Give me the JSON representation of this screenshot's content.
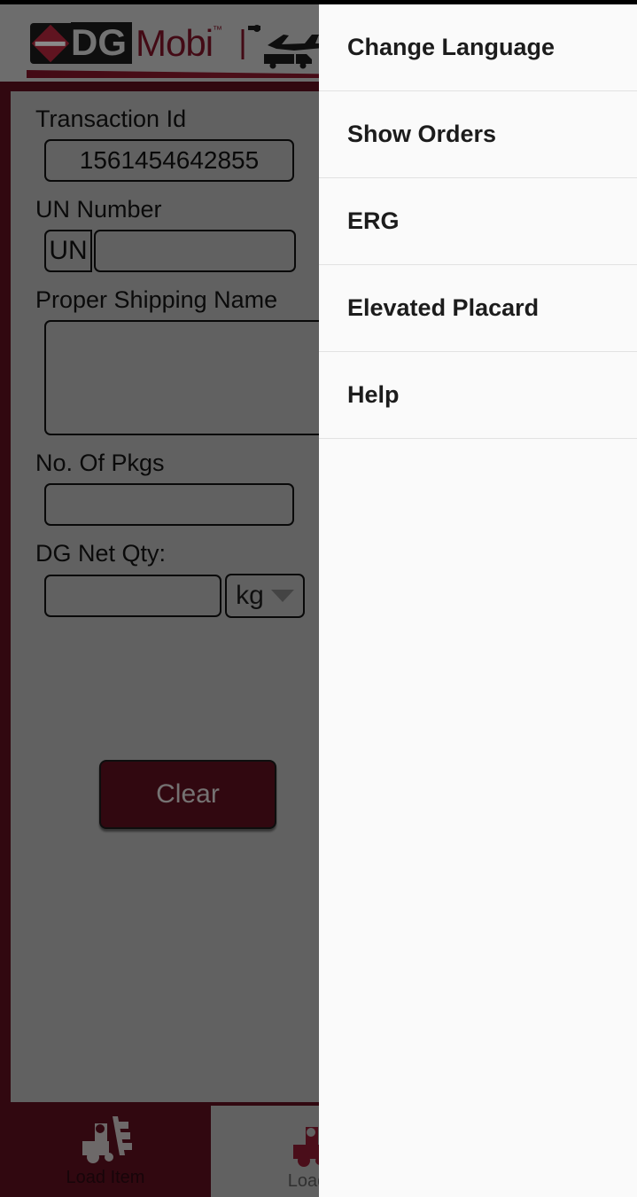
{
  "header": {
    "logo_dg": "DG",
    "logo_mobi": "Mobi",
    "logo_tm": "™",
    "transport_art": "airplane-truck-ship-silhouette"
  },
  "form": {
    "transaction": {
      "label": "Transaction Id",
      "value": "1561454642855"
    },
    "un_number": {
      "label": "UN Number",
      "prefix": "UN",
      "value": ""
    },
    "proper_shipping_name": {
      "label": "Proper Shipping Name",
      "value": ""
    },
    "no_of_pkgs": {
      "label": "No. Of Pkgs",
      "value": ""
    },
    "dg_net_qty": {
      "label": "DG Net Qty:",
      "value": "",
      "unit": "kg"
    },
    "clear_button": "Clear"
  },
  "tabs": [
    {
      "label": "Load Item",
      "icon": "forklift-icon",
      "active": true
    },
    {
      "label": "Load D",
      "icon": "forklift-icon",
      "active": false
    }
  ],
  "menu": {
    "items": [
      {
        "label": "Change Language"
      },
      {
        "label": "Show Orders"
      },
      {
        "label": "ERG"
      },
      {
        "label": "Elevated Placard"
      },
      {
        "label": "Help"
      }
    ]
  },
  "colors": {
    "brand_dark_red": "#5c0f1e",
    "brand_red": "#7d1427",
    "panel_gray": "#b4b4b4",
    "menu_bg": "#fafafa",
    "divider": "#e2e2e2"
  }
}
